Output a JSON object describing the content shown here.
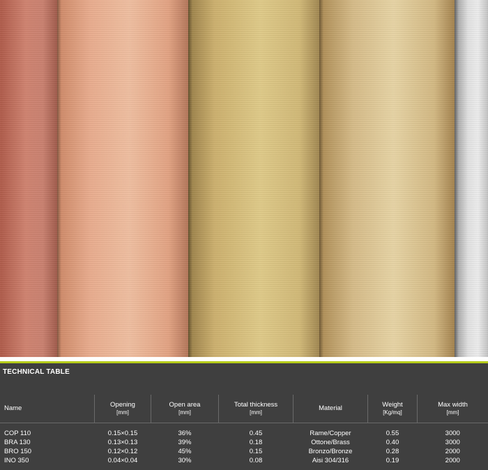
{
  "photo": {
    "description_icon": "metal-mesh-rolls-photo"
  },
  "colors": {
    "panel_bg": "#3f3f3f",
    "accent": "#b5cc1a",
    "text": "#ffffff"
  },
  "table": {
    "title": "TECHNICAL TABLE",
    "columns": [
      {
        "label": "Name",
        "unit": ""
      },
      {
        "label": "Opening",
        "unit": "[mm]"
      },
      {
        "label": "Open area",
        "unit": "[mm]"
      },
      {
        "label": "Total thickness",
        "unit": "[mm]"
      },
      {
        "label": "Material",
        "unit": ""
      },
      {
        "label": "Weight",
        "unit": "[Kg/mq]"
      },
      {
        "label": "Max width",
        "unit": "[mm]"
      }
    ],
    "rows": [
      [
        "COP 110",
        "0.15×0.15",
        "36%",
        "0.45",
        "Rame/Copper",
        "0.55",
        "3000"
      ],
      [
        "BRA 130",
        "0.13×0.13",
        "39%",
        "0.18",
        "Ottone/Brass",
        "0.40",
        "3000"
      ],
      [
        "BRO 150",
        "0.12×0.12",
        "45%",
        "0.15",
        "Bronzo/Bronze",
        "0.28",
        "2000"
      ],
      [
        "INO 350",
        "0.04×0.04",
        "30%",
        "0.08",
        "Aisi 304/316",
        "0.19",
        "2000"
      ]
    ]
  }
}
